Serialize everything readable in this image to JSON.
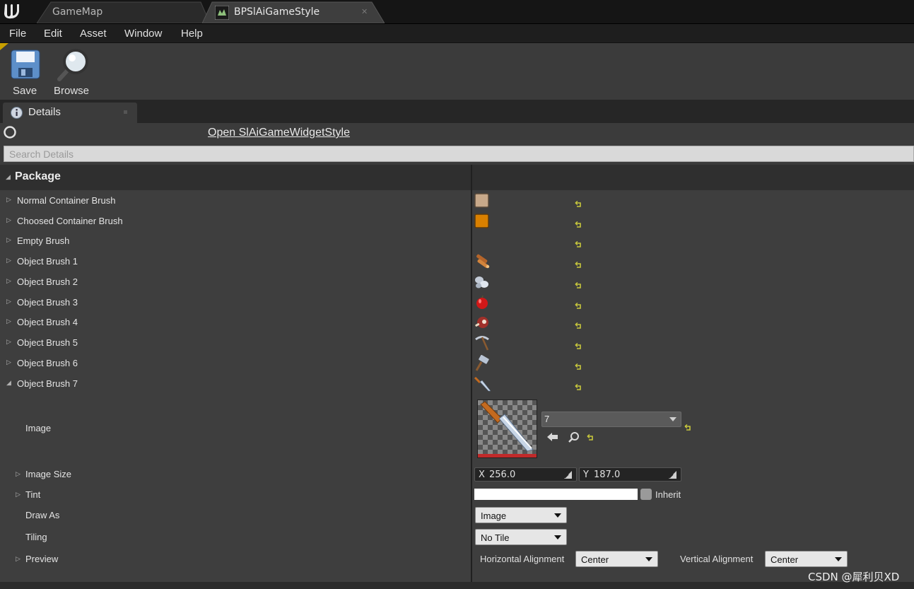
{
  "tabs": [
    {
      "label": "GameMap",
      "active": false
    },
    {
      "label": "BPSlAiGameStyle",
      "active": true
    }
  ],
  "menu": [
    "File",
    "Edit",
    "Asset",
    "Window",
    "Help"
  ],
  "toolbar": {
    "save_label": "Save",
    "browse_label": "Browse"
  },
  "details_tab": {
    "label": "Details"
  },
  "open_link": "Open SlAiGameWidgetStyle",
  "search": {
    "placeholder": "Search Details"
  },
  "category": "Package",
  "rows": [
    {
      "label": "Normal Container Brush",
      "icon": "container-normal-icon"
    },
    {
      "label": "Choosed Container Brush",
      "icon": "container-chosen-icon"
    },
    {
      "label": "Empty Brush",
      "icon": ""
    },
    {
      "label": "Object Brush 1",
      "icon": "wood-logs-icon"
    },
    {
      "label": "Object Brush 2",
      "icon": "stones-icon"
    },
    {
      "label": "Object Brush 3",
      "icon": "apple-icon"
    },
    {
      "label": "Object Brush 4",
      "icon": "meat-icon"
    },
    {
      "label": "Object Brush 5",
      "icon": "pickaxe-icon"
    },
    {
      "label": "Object Brush 6",
      "icon": "hammer-icon"
    },
    {
      "label": "Object Brush 7",
      "icon": "knife-icon"
    }
  ],
  "expanded": {
    "image_label": "Image",
    "image_asset": "7",
    "image_size_label": "Image Size",
    "x_label": "X",
    "x_value": "256.0",
    "y_label": "Y",
    "y_value": "187.0",
    "tint_label": "Tint",
    "inherit_label": "Inherit",
    "draw_as_label": "Draw As",
    "draw_as_value": "Image",
    "tiling_label": "Tiling",
    "tiling_value": "No Tile",
    "preview_label": "Preview",
    "h_align_label": "Horizontal Alignment",
    "h_align_value": "Center",
    "v_align_label": "Vertical Alignment",
    "v_align_value": "Center"
  },
  "watermark": "CSDN @犀利贝XD",
  "colors": {
    "reset_arrow": "#c8c83c",
    "accent_tab": "#c8a000"
  }
}
